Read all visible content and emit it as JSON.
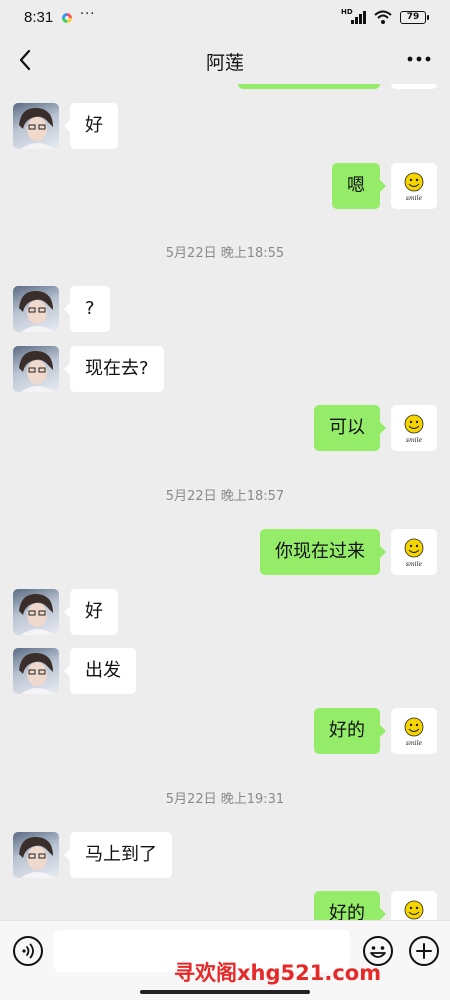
{
  "status": {
    "time": "8:31",
    "network": "HD",
    "battery": "79"
  },
  "header": {
    "title": "阿莲"
  },
  "smile_text": "smile",
  "messages": [
    {
      "side": "in",
      "text": "好"
    },
    {
      "side": "out",
      "text": "嗯"
    },
    {
      "type": "time",
      "text": "5月22日 晚上18:55"
    },
    {
      "side": "in",
      "text": "?"
    },
    {
      "side": "in",
      "text": "现在去?"
    },
    {
      "side": "out",
      "text": "可以"
    },
    {
      "type": "time",
      "text": "5月22日 晚上18:57"
    },
    {
      "side": "out",
      "text": "你现在过来"
    },
    {
      "side": "in",
      "text": "好"
    },
    {
      "side": "in",
      "text": "出发"
    },
    {
      "side": "out",
      "text": "好的"
    },
    {
      "type": "time",
      "text": "5月22日 晚上19:31"
    },
    {
      "side": "in",
      "text": "马上到了"
    },
    {
      "side": "out",
      "text": "好的"
    }
  ],
  "input": {
    "placeholder": ""
  },
  "watermark": "寻欢阁xhg521.com",
  "colors": {
    "background": "#ededed",
    "bubble_out": "#95ec69",
    "bubble_in": "#ffffff",
    "watermark": "#e62a2a"
  }
}
